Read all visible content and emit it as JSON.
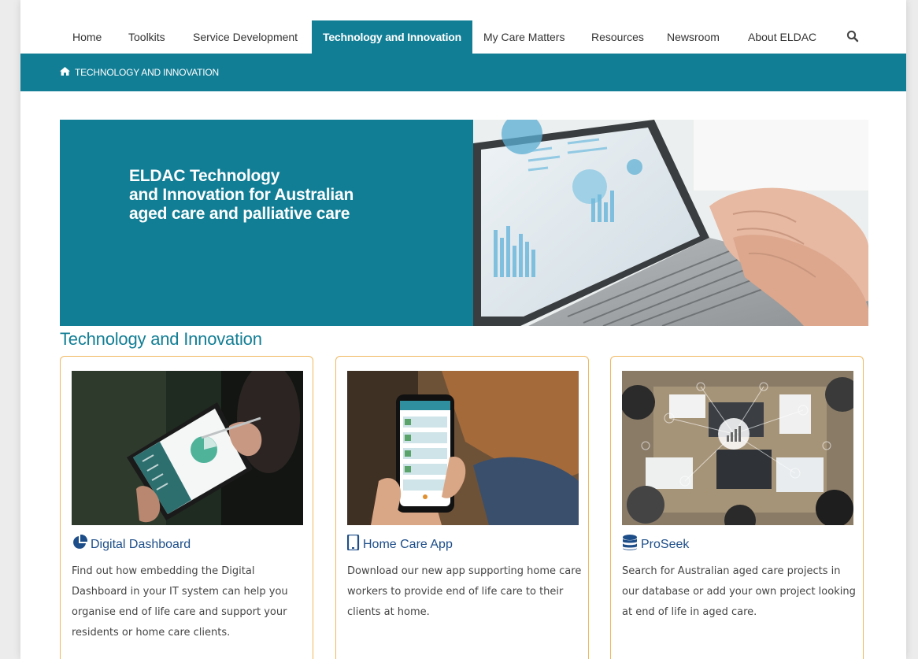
{
  "nav": {
    "items": [
      {
        "label": "Home"
      },
      {
        "label": "Toolkits"
      },
      {
        "label": "Service Development"
      },
      {
        "label": "Technology and Innovation",
        "active": true
      },
      {
        "label": "My Care Matters"
      },
      {
        "label": "Resources"
      },
      {
        "label": "Newsroom"
      },
      {
        "label": "About ELDAC"
      }
    ],
    "search_icon": "search-icon"
  },
  "breadcrumb": {
    "icon": "home-icon",
    "label": "TECHNOLOGY AND INNOVATION"
  },
  "hero": {
    "title_lines": [
      "ELDAC Technology",
      "and Innovation for Australian",
      "aged care and palliative care"
    ]
  },
  "section": {
    "heading": "Technology and Innovation"
  },
  "cards": [
    {
      "icon": "pie-chart-icon",
      "title": "Digital Dashboard",
      "description": "Find out how embedding the Digital Dashboard in your IT system can help you organise end of life care and support your residents or home care clients."
    },
    {
      "icon": "mobile-phone-icon",
      "title": "Home Care App",
      "description": "Download our new app supporting home care workers to provide end of life care to their clients at home."
    },
    {
      "icon": "database-icon",
      "title": "ProSeek",
      "description": "Search for Australian aged care projects in our database or add your own project looking at end of life in aged care."
    }
  ],
  "colors": {
    "brand_teal": "#127e95",
    "card_border": "#f0b860",
    "link_blue": "#1d4e89"
  }
}
